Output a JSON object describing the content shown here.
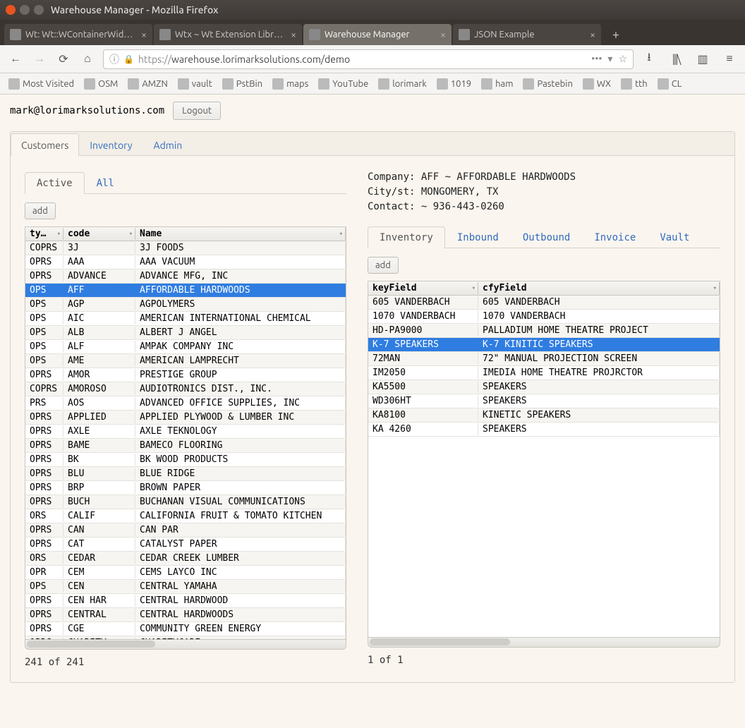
{
  "window": {
    "title": "Warehouse Manager - Mozilla Firefox"
  },
  "browser_tabs": [
    {
      "label": "Wt: Wt::WContainerWidget",
      "active": false
    },
    {
      "label": "Wtx ~ Wt Extension Library",
      "active": false
    },
    {
      "label": "Warehouse Manager",
      "active": true
    },
    {
      "label": "JSON Example",
      "active": false
    }
  ],
  "url": {
    "scheme": "https://",
    "rest": "warehouse.lorimarksolutions.com/demo"
  },
  "bookmarks": [
    "Most Visited",
    "OSM",
    "AMZN",
    "vault",
    "PstBin",
    "maps",
    "YouTube",
    "lorimark",
    "1019",
    "ham",
    "Pastebin",
    "WX",
    "tth",
    "CL"
  ],
  "user": {
    "email": "mark@lorimarksolutions.com",
    "logout": "Logout"
  },
  "main_tabs": {
    "items": [
      "Customers",
      "Inventory",
      "Admin"
    ],
    "active": "Customers"
  },
  "left": {
    "tabs": {
      "items": [
        "Active",
        "All"
      ],
      "active": "Active"
    },
    "add_label": "add",
    "columns": [
      "ty…",
      "code",
      "Name"
    ],
    "rows": [
      [
        "COPRS",
        "3J",
        "3J FOODS"
      ],
      [
        "OPRS",
        "AAA",
        "AAA VACUUM"
      ],
      [
        "OPRS",
        "ADVANCE",
        "ADVANCE MFG, INC"
      ],
      [
        "OPS",
        "AFF",
        "AFFORDABLE HARDWOODS"
      ],
      [
        "OPS",
        "AGP",
        "AGPOLYMERS"
      ],
      [
        "OPS",
        "AIC",
        "AMERICAN INTERNATIONAL CHEMICAL"
      ],
      [
        "OPS",
        "ALB",
        "ALBERT J ANGEL"
      ],
      [
        "OPS",
        "ALF",
        "AMPAK COMPANY INC"
      ],
      [
        "OPS",
        "AME",
        "AMERICAN LAMPRECHT"
      ],
      [
        "OPRS",
        "AMOR",
        "PRESTIGE GROUP"
      ],
      [
        "COPRS",
        "AMOROSO",
        "AUDIOTRONICS DIST., INC."
      ],
      [
        "PRS",
        "AOS",
        "ADVANCED OFFICE SUPPLIES, INC"
      ],
      [
        "OPRS",
        "APPLIED",
        "APPLIED PLYWOOD & LUMBER INC"
      ],
      [
        "OPRS",
        "AXLE",
        "AXLE TEKNOLOGY"
      ],
      [
        "OPRS",
        "BAME",
        "BAMECO FLOORING"
      ],
      [
        "OPRS",
        "BK",
        "BK WOOD PRODUCTS"
      ],
      [
        "OPRS",
        "BLU",
        "BLUE RIDGE"
      ],
      [
        "OPRS",
        "BRP",
        "BROWN PAPER"
      ],
      [
        "OPRS",
        "BUCH",
        "BUCHANAN VISUAL COMMUNICATIONS"
      ],
      [
        "ORS",
        "CALIF",
        "CALIFORNIA FRUIT & TOMATO KITCHEN"
      ],
      [
        "OPRS",
        "CAN",
        "CAN PAR"
      ],
      [
        "OPRS",
        "CAT",
        "CATALYST PAPER"
      ],
      [
        "ORS",
        "CEDAR",
        "CEDAR CREEK LUMBER"
      ],
      [
        "OPR",
        "CEM",
        "CEMS LAYCO INC"
      ],
      [
        "OPS",
        "CEN",
        "CENTRAL YAMAHA"
      ],
      [
        "OPRS",
        "CEN HAR",
        "CENTRAL HARDWOOD"
      ],
      [
        "OPRS",
        "CENTRAL",
        "CENTRAL HARDWOODS"
      ],
      [
        "OPRS",
        "CGE",
        "COMMUNITY GREEN ENERGY"
      ],
      [
        "OPRS",
        "CHARITY",
        "CHARITYCARE"
      ]
    ],
    "selected_index": 3,
    "status": "241 of 241"
  },
  "right": {
    "company": {
      "line1": "Company: AFF ~ AFFORDABLE HARDWOODS",
      "line2": "City/st: MONGOMERY, TX",
      "line3": "Contact: ~ 936-443-0260"
    },
    "tabs": {
      "items": [
        "Inventory",
        "Inbound",
        "Outbound",
        "Invoice",
        "Vault"
      ],
      "active": "Inventory"
    },
    "add_label": "add",
    "columns": [
      "keyField",
      "cfyField"
    ],
    "rows": [
      [
        "605 VANDERBACH",
        "605 VANDERBACH"
      ],
      [
        "1070 VANDERBACH",
        "1070 VANDERBACH"
      ],
      [
        "HD-PA9000",
        "PALLADIUM HOME THEATRE PROJECT"
      ],
      [
        "K-7 SPEAKERS",
        "K-7 KINITIC SPEAKERS"
      ],
      [
        "72MAN",
        "72\" MANUAL PROJECTION SCREEN"
      ],
      [
        "IM2050",
        "IMEDIA HOME THEATRE PROJRCTOR"
      ],
      [
        "KA5500",
        "SPEAKERS"
      ],
      [
        "WD306HT",
        "SPEAKERS"
      ],
      [
        "KA8100",
        "KINETIC SPEAKERS"
      ],
      [
        "KA 4260",
        "SPEAKERS"
      ]
    ],
    "selected_index": 3,
    "status": "1 of 1"
  }
}
